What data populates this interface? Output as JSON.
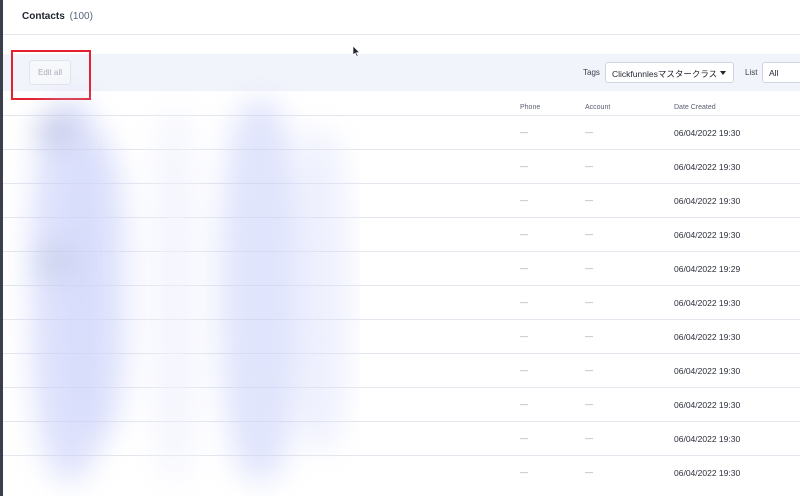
{
  "header": {
    "title": "Contacts",
    "count": "(100)"
  },
  "toolbar": {
    "edit_all_label": "Edit all",
    "tags_label": "Tags",
    "tags_value": "Clickfunnlesマスタークラス",
    "list_label": "List",
    "list_value": "All"
  },
  "table": {
    "columns": [
      "Phone",
      "Account",
      "Date Created"
    ],
    "rows": [
      {
        "phone": "—",
        "account": "—",
        "date_created": "06/04/2022 19:30"
      },
      {
        "phone": "—",
        "account": "—",
        "date_created": "06/04/2022 19:30"
      },
      {
        "phone": "—",
        "account": "—",
        "date_created": "06/04/2022 19:30"
      },
      {
        "phone": "—",
        "account": "—",
        "date_created": "06/04/2022 19:30"
      },
      {
        "phone": "—",
        "account": "—",
        "date_created": "06/04/2022 19:29"
      },
      {
        "phone": "—",
        "account": "—",
        "date_created": "06/04/2022 19:30"
      },
      {
        "phone": "—",
        "account": "—",
        "date_created": "06/04/2022 19:30"
      },
      {
        "phone": "—",
        "account": "—",
        "date_created": "06/04/2022 19:30"
      },
      {
        "phone": "—",
        "account": "—",
        "date_created": "06/04/2022 19:30"
      },
      {
        "phone": "—",
        "account": "—",
        "date_created": "06/04/2022 19:30"
      },
      {
        "phone": "—",
        "account": "—",
        "date_created": "06/04/2022 19:30"
      }
    ]
  },
  "colors": {
    "highlight": "#e3222e",
    "toolbar_bg": "#f2f4fb"
  }
}
